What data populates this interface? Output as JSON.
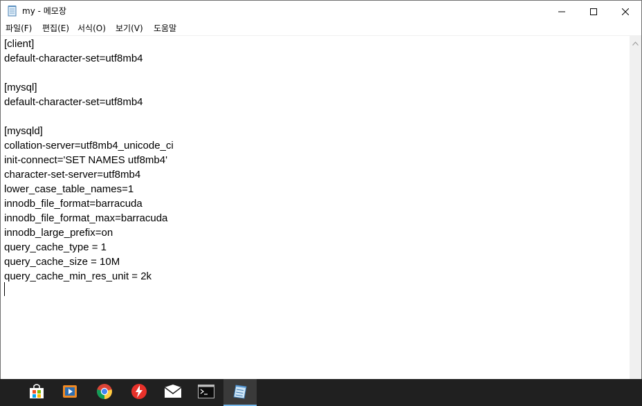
{
  "window": {
    "title": "my - 메모장",
    "app_icon": "notepad-icon",
    "controls": {
      "minimize_icon": "minimize-icon",
      "maximize_icon": "maximize-icon",
      "close_icon": "close-icon"
    }
  },
  "menu": {
    "file": "파일(F)",
    "edit": "편집(E)",
    "format": "서식(O)",
    "view": "보기(V)",
    "help": "도움말"
  },
  "editor": {
    "lines": [
      "[client]",
      "default-character-set=utf8mb4",
      "",
      "[mysql]",
      "default-character-set=utf8mb4",
      "",
      "[mysqld]",
      "collation-server=utf8mb4_unicode_ci",
      "init-connect='SET NAMES utf8mb4'",
      "character-set-server=utf8mb4",
      "lower_case_table_names=1",
      "innodb_file_format=barracuda",
      "innodb_file_format_max=barracuda",
      "innodb_large_prefix=on",
      "query_cache_type = 1",
      "query_cache_size = 10M",
      "query_cache_min_res_unit = 2k"
    ]
  },
  "taskbar": {
    "items": [
      {
        "icon": "store-icon"
      },
      {
        "icon": "media-player-icon"
      },
      {
        "icon": "chrome-icon"
      },
      {
        "icon": "flash-app-icon"
      },
      {
        "icon": "mail-icon"
      },
      {
        "icon": "terminal-icon"
      },
      {
        "icon": "notepad-icon",
        "active": true
      }
    ]
  },
  "colors": {
    "taskbar_bg": "#202020",
    "active_indicator": "#76b9ed",
    "scrollbar_bg": "#f0f0f0"
  }
}
